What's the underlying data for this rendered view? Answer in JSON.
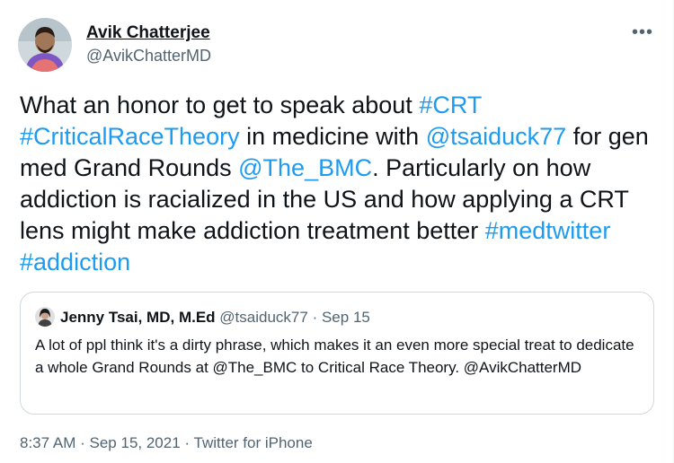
{
  "author": {
    "name": "Avik Chatterjee",
    "handle": "@AvikChatterMD"
  },
  "more_icon": "more-horizontal-icon",
  "tweet": {
    "segments": [
      {
        "text": "What an honor to get to speak about ",
        "link": false
      },
      {
        "text": "#CRT",
        "link": true
      },
      {
        "text": " ",
        "link": false
      },
      {
        "text": "#CriticalRaceTheory",
        "link": true
      },
      {
        "text": " in medicine with ",
        "link": false
      },
      {
        "text": "@tsaiduck77",
        "link": true
      },
      {
        "text": " for gen med Grand Rounds ",
        "link": false
      },
      {
        "text": "@The_BMC",
        "link": true
      },
      {
        "text": ". Particularly on how addiction is racialized in the US and how applying a CRT lens might make addiction treatment better ",
        "link": false
      },
      {
        "text": "#medtwitter",
        "link": true
      },
      {
        "text": " ",
        "link": false
      },
      {
        "text": "#addiction",
        "link": true
      }
    ]
  },
  "quote": {
    "name": "Jenny Tsai, MD, M.Ed",
    "handle": "@tsaiduck77",
    "separator": "·",
    "date": "Sep 15",
    "text": "A lot of ppl think it's a dirty phrase, which makes it an even more special treat to dedicate a whole Grand Rounds at @The_BMC to Critical Race Theory. @AvikChatterMD"
  },
  "footer": {
    "time": "8:37 AM",
    "separator": "·",
    "date": "Sep 15, 2021",
    "source": "Twitter for iPhone"
  },
  "colors": {
    "link": "#1d9bf0",
    "text": "#0f1419",
    "muted": "#536471",
    "border": "#cfd9de"
  }
}
